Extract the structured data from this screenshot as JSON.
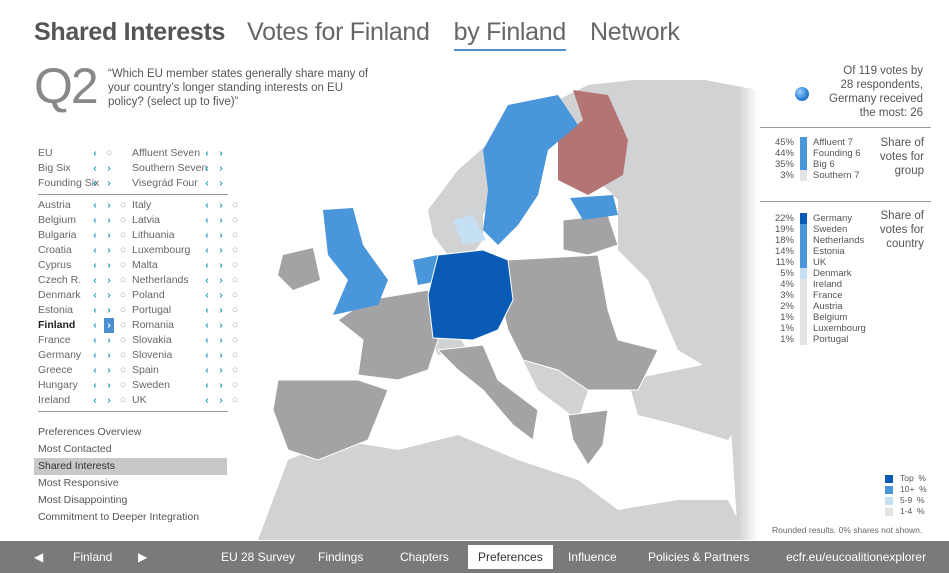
{
  "header": {
    "title": "Shared Interests",
    "tabs": [
      {
        "label": "Votes for Finland",
        "active": false
      },
      {
        "label": "by Finland",
        "active": true
      },
      {
        "label": "Network",
        "active": false
      }
    ]
  },
  "question": {
    "number": "Q2",
    "text": "“Which EU member states generally share many of your country’s longer standing interests on EU policy? (select up to five)”"
  },
  "groups": {
    "left": [
      "EU",
      "Big Six",
      "Founding Six"
    ],
    "right": [
      "Affluent Seven",
      "Southern Seven",
      "Visegrád Four"
    ]
  },
  "countries": {
    "left": [
      "Austria",
      "Belgium",
      "Bulgaria",
      "Croatia",
      "Cyprus",
      "Czech R.",
      "Denmark",
      "Estonia",
      "Finland",
      "France",
      "Germany",
      "Greece",
      "Hungary",
      "Ireland"
    ],
    "right": [
      "Italy",
      "Latvia",
      "Lithuania",
      "Luxembourg",
      "Malta",
      "Netherlands",
      "Poland",
      "Portugal",
      "Romania",
      "Slovakia",
      "Slovenia",
      "Spain",
      "Sweden",
      "UK"
    ],
    "selected": "Finland"
  },
  "menu": {
    "items": [
      "Preferences Overview",
      "Most Contacted",
      "Shared Interests",
      "Most Responsive",
      "Most Disappointing",
      "Commitment to Deeper Integration"
    ],
    "active": "Shared Interests"
  },
  "summary": {
    "line1": "Of 119 votes by",
    "line2": "28 respondents,",
    "line3": "Germany received",
    "line4": "the most: 26"
  },
  "group_share": {
    "title1": "Share of",
    "title2": "votes for",
    "title3": "group",
    "rows": [
      {
        "pct": "45%",
        "label": "Affluent 7",
        "tier": "10+"
      },
      {
        "pct": "44%",
        "label": "Founding 6",
        "tier": "10+"
      },
      {
        "pct": "35%",
        "label": "Big 6",
        "tier": "10+"
      },
      {
        "pct": "3%",
        "label": "Southern 7",
        "tier": "1-4"
      }
    ]
  },
  "country_share": {
    "title1": "Share of",
    "title2": "votes for",
    "title3": "country",
    "rows": [
      {
        "pct": "22%",
        "label": "Germany",
        "tier": "top"
      },
      {
        "pct": "19%",
        "label": "Sweden",
        "tier": "10+"
      },
      {
        "pct": "18%",
        "label": "Netherlands",
        "tier": "10+"
      },
      {
        "pct": "14%",
        "label": "Estonia",
        "tier": "10+"
      },
      {
        "pct": "11%",
        "label": "UK",
        "tier": "10+"
      },
      {
        "pct": "5%",
        "label": "Denmark",
        "tier": "5-9"
      },
      {
        "pct": "4%",
        "label": "Ireland",
        "tier": "1-4"
      },
      {
        "pct": "3%",
        "label": "France",
        "tier": "1-4"
      },
      {
        "pct": "2%",
        "label": "Austria",
        "tier": "1-4"
      },
      {
        "pct": "1%",
        "label": "Belgium",
        "tier": "1-4"
      },
      {
        "pct": "1%",
        "label": "Luxembourg",
        "tier": "1-4"
      },
      {
        "pct": "1%",
        "label": "Portugal",
        "tier": "1-4"
      }
    ]
  },
  "legend": {
    "items": [
      {
        "label": "Top  %",
        "color": "#0a5bb5"
      },
      {
        "label": "10+  %",
        "color": "#4a96db"
      },
      {
        "label": "5-9  %",
        "color": "#c5e0f2"
      },
      {
        "label": "1-4  %",
        "color": "#e3e3e3"
      }
    ],
    "note": "Rounded results. 0% shares not shown."
  },
  "colors": {
    "top": "#0a5bb5",
    "ten_plus": "#4a96db",
    "five_nine": "#c5e0f2",
    "one_four": "#e3e3e3",
    "selected_country": "#b57474",
    "eu_gray": "#a3a3a5",
    "non_eu": "#d0d2d3"
  },
  "bottom_nav": {
    "country": "Finland",
    "items": [
      "EU 28 Survey",
      "Findings",
      "Chapters",
      "Preferences",
      "Influence",
      "Policies & Partners"
    ],
    "active": "Preferences",
    "site": "ecfr.eu/eucoalitionexplorer"
  }
}
